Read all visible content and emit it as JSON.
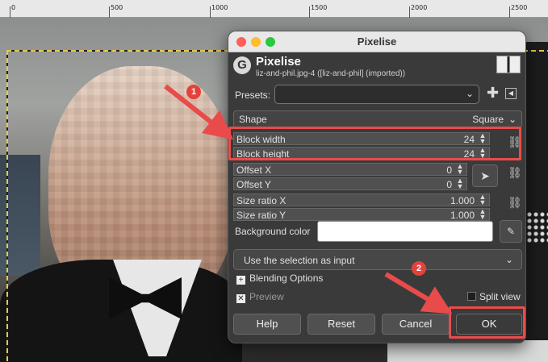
{
  "ruler": {
    "labels": [
      "0",
      "500",
      "1000",
      "1500",
      "2000",
      "2500"
    ]
  },
  "dialog": {
    "window_title": "Pixelise",
    "header_title": "Pixelise",
    "header_subtitle": "liz-and-phil.jpg-4 ([liz-and-phil] (imported))",
    "presets_label": "Presets:",
    "presets_value": "",
    "shape_label": "Shape",
    "shape_value": "Square",
    "fields": [
      {
        "label": "Block width",
        "value": "24"
      },
      {
        "label": "Block height",
        "value": "24"
      },
      {
        "label": "Offset X",
        "value": "0"
      },
      {
        "label": "Offset Y",
        "value": "0"
      },
      {
        "label": "Size ratio X",
        "value": "1.000"
      },
      {
        "label": "Size ratio Y",
        "value": "1.000"
      }
    ],
    "background_color_label": "Background color",
    "background_color": "#ffffff",
    "selection_input": "Use the selection as input",
    "blending_options": "Blending Options",
    "preview_label": "Preview",
    "split_view_label": "Split view",
    "buttons": {
      "help": "Help",
      "reset": "Reset",
      "cancel": "Cancel",
      "ok": "OK"
    }
  },
  "annotations": {
    "badge_1": "1",
    "badge_2": "2",
    "highlight_color": "#e94b4b"
  },
  "icons": [
    "gimp-logo-icon",
    "chevron-down-icon",
    "plus-icon",
    "back-icon",
    "chain-link-icon",
    "pointer-icon",
    "color-picker-icon"
  ]
}
